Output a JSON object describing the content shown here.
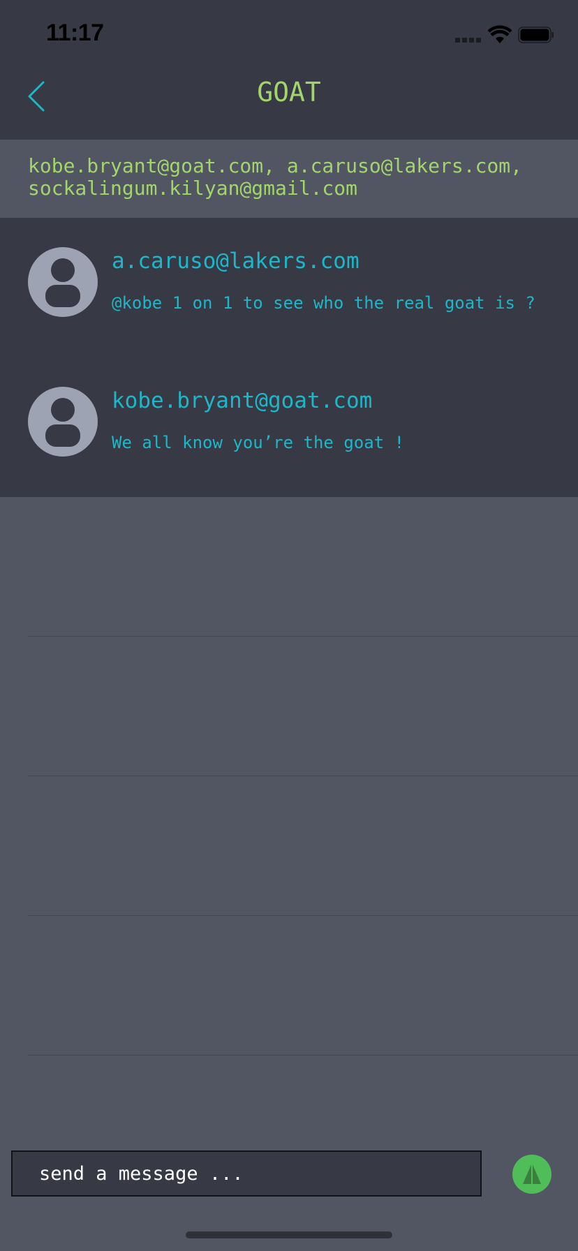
{
  "status_bar": {
    "time": "11:17"
  },
  "nav": {
    "title": "GOAT"
  },
  "participants": {
    "text": "kobe.bryant@goat.com, a.caruso@lakers.com,\nsockalingum.kilyan@gmail.com"
  },
  "messages": [
    {
      "author": "a.caruso@lakers.com",
      "text": "@kobe 1 on 1 to see who the real goat is ?"
    },
    {
      "author": "kobe.bryant@goat.com",
      "text": "We all know you’re the goat !"
    }
  ],
  "composer": {
    "placeholder": "send a message ..."
  },
  "icons": {
    "back": "chevron-left-icon",
    "avatar": "user-avatar-icon",
    "send": "send-arrow-icon",
    "wifi": "wifi-icon",
    "battery": "battery-icon",
    "signal": "cellular-signal-icon"
  },
  "colors": {
    "accent_green": "#a2d66d",
    "accent_cyan": "#1cb8c9",
    "send_green": "#4fbe58",
    "dark_bg": "#373945",
    "light_bg": "#525663"
  }
}
